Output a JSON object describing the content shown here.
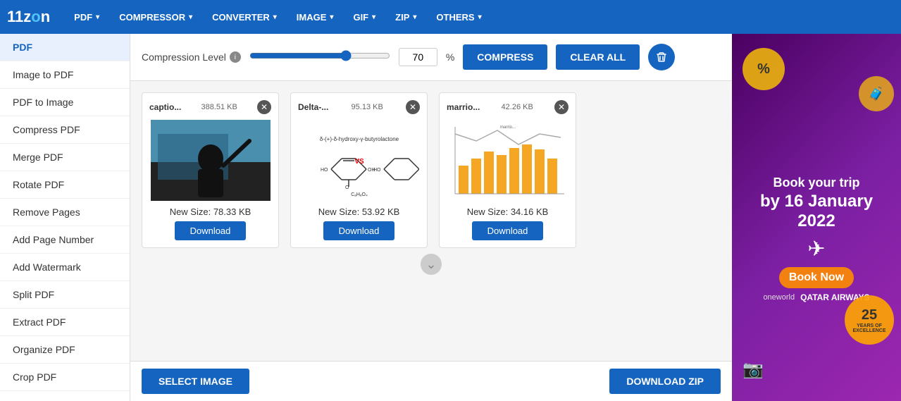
{
  "app": {
    "logo": "11zon",
    "logo_accent": "o"
  },
  "nav": {
    "items": [
      {
        "label": "PDF",
        "id": "pdf"
      },
      {
        "label": "COMPRESSOR",
        "id": "compressor"
      },
      {
        "label": "CONVERTER",
        "id": "converter"
      },
      {
        "label": "IMAGE",
        "id": "image"
      },
      {
        "label": "GIF",
        "id": "gif"
      },
      {
        "label": "ZIP",
        "id": "zip"
      },
      {
        "label": "OTHERS",
        "id": "others"
      }
    ]
  },
  "sidebar": {
    "items": [
      {
        "label": "PDF",
        "active": true
      },
      {
        "label": "Image to PDF"
      },
      {
        "label": "PDF to Image"
      },
      {
        "label": "Compress PDF"
      },
      {
        "label": "Merge PDF"
      },
      {
        "label": "Rotate PDF"
      },
      {
        "label": "Remove Pages"
      },
      {
        "label": "Add Page Number"
      },
      {
        "label": "Add Watermark"
      },
      {
        "label": "Split PDF"
      },
      {
        "label": "Extract PDF"
      },
      {
        "label": "Organize PDF"
      },
      {
        "label": "Crop PDF"
      }
    ]
  },
  "toolbar": {
    "compression_label": "Compression Level",
    "slider_value": 70,
    "percent_symbol": "%",
    "compress_btn": "COMPRESS",
    "clear_btn": "CLEAR ALL"
  },
  "files": [
    {
      "filename": "captio...",
      "size": "388.51 KB",
      "new_size": "New Size: 78.33 KB",
      "download_label": "Download",
      "preview_type": "person"
    },
    {
      "filename": "Delta-...",
      "size": "95.13 KB",
      "new_size": "New Size: 53.92 KB",
      "download_label": "Download",
      "preview_type": "chem"
    },
    {
      "filename": "marrio...",
      "size": "42.26 KB",
      "new_size": "New Size: 34.16 KB",
      "download_label": "Download",
      "preview_type": "chart"
    }
  ],
  "bottom": {
    "select_btn": "SELECT IMAGE",
    "download_zip_btn": "DOWNLOAD ZIP"
  },
  "ad": {
    "line1": "Book your trip",
    "line2": "by 16 January",
    "line3": "2022",
    "badge": "25 YEARS OF EXCELLENCE",
    "book_now": "Book Now",
    "brand": "oneworld",
    "airline": "QATAR AIRWAYS",
    "percent": "%"
  }
}
